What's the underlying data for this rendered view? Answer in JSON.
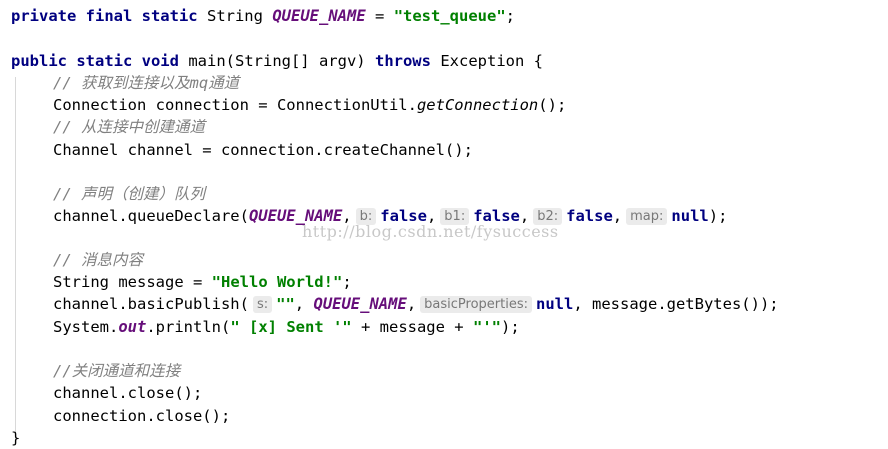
{
  "code": {
    "l1": {
      "kw": "private final static",
      "type": "String",
      "const": "QUEUE_NAME",
      "eq": "=",
      "str": "\"test_queue\"",
      "end": ";"
    },
    "l2": {
      "kw1": "public static void",
      "sig": "main(String[] argv)",
      "kw2": "throws",
      "rest": "Exception {"
    },
    "c1": "// 获取到连接以及mq通道",
    "l3": {
      "a": "Connection connection = ConnectionUtil.",
      "b": "getConnection",
      "c": "();"
    },
    "c2": "// 从连接中创建通道",
    "l4": "Channel channel = connection.createChannel();",
    "c3": "// 声明（创建）队列",
    "l5": {
      "a": "channel.queueDeclare(",
      "const": "QUEUE_NAME",
      "comma1": ",",
      "hint1": "b:",
      "v1": "false",
      "comma2": ",",
      "hint2": "b1:",
      "v2": "false",
      "comma3": ",",
      "hint3": "b2:",
      "v3": "false",
      "comma4": ",",
      "hint4": "map:",
      "v4": "null",
      "end": ");"
    },
    "c4": "// 消息内容",
    "l6": {
      "a": "String message =",
      "str": "\"Hello World!\"",
      "end": ";"
    },
    "l7": {
      "a": "channel.basicPublish(",
      "hint1": "s:",
      "str": "\"\"",
      "comma1": ",",
      "const": "QUEUE_NAME",
      "comma2": ",",
      "hint2": "basicProperties:",
      "v": "null",
      "end": ", message.getBytes());"
    },
    "l8": {
      "a": "System.",
      "out": "out",
      "b": ".println(",
      "s1": "\" [x] Sent '\"",
      "c": " + message + ",
      "s2": "\"'\"",
      "end": ");"
    },
    "c5": "//关闭通道和连接",
    "l9": "channel.close();",
    "l10": "connection.close();",
    "l11": "}"
  },
  "watermark": "http://blog.csdn.net/fysuccess"
}
